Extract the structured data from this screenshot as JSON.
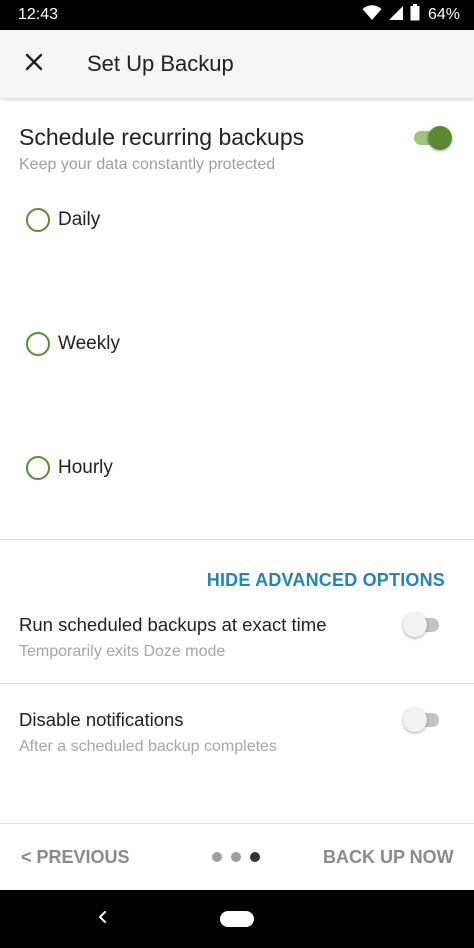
{
  "status_bar": {
    "time": "12:43",
    "battery": "64%"
  },
  "header": {
    "title": "Set Up Backup",
    "close_icon": "close-icon"
  },
  "schedule": {
    "title": "Schedule recurring backups",
    "subtitle": "Keep your data constantly protected",
    "enabled": true,
    "accent_color": "#5d8a2f",
    "options": [
      {
        "label": "Daily",
        "selected": false
      },
      {
        "label": "Weekly",
        "selected": false
      },
      {
        "label": "Hourly",
        "selected": false
      }
    ]
  },
  "advanced": {
    "toggle_label": "HIDE ADVANCED OPTIONS",
    "link_color": "#1f86b7",
    "settings": [
      {
        "title": "Run scheduled backups at exact time",
        "subtitle": "Temporarily exits Doze mode",
        "enabled": false
      },
      {
        "title": "Disable notifications",
        "subtitle": "After a scheduled backup completes",
        "enabled": false
      }
    ]
  },
  "footer": {
    "previous_label": "< PREVIOUS",
    "next_label": "BACK UP NOW",
    "page_count": 3,
    "current_page": 3
  }
}
